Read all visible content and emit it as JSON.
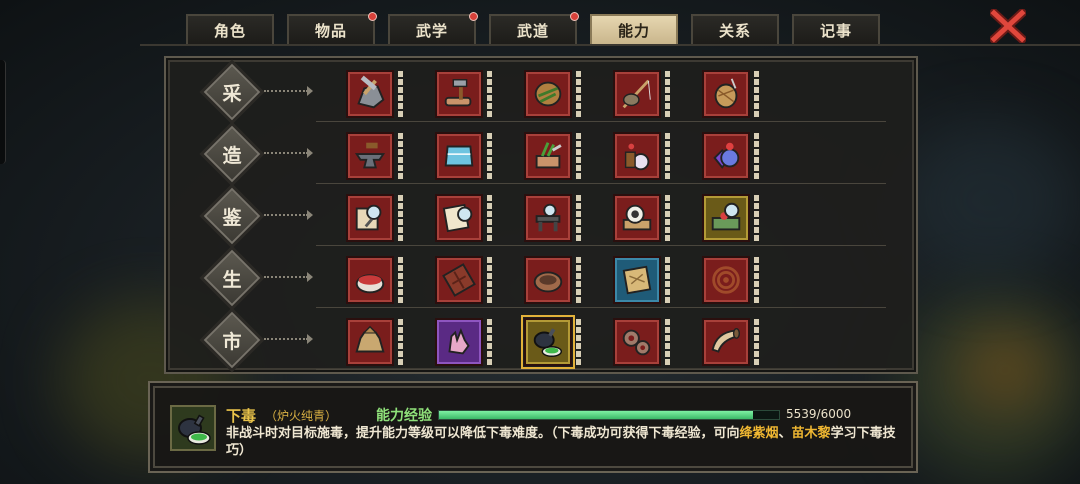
{
  "tabs": [
    {
      "label": "角色",
      "dot": false,
      "active": false
    },
    {
      "label": "物品",
      "dot": true,
      "active": false
    },
    {
      "label": "武学",
      "dot": true,
      "active": false
    },
    {
      "label": "武道",
      "dot": true,
      "active": false
    },
    {
      "label": "能力",
      "dot": false,
      "active": true
    },
    {
      "label": "关系",
      "dot": false,
      "active": false
    },
    {
      "label": "记事",
      "dot": false,
      "active": false
    }
  ],
  "close_icon": "close-x-icon",
  "rows": [
    {
      "label": "采",
      "skills": [
        {
          "icon": "ore-mining-icon",
          "color": "red",
          "level": 5
        },
        {
          "icon": "axe-wood-icon",
          "color": "red",
          "level": 5
        },
        {
          "icon": "herb-basket-icon",
          "color": "red",
          "level": 5
        },
        {
          "icon": "fishing-rod-icon",
          "color": "red",
          "level": 5
        },
        {
          "icon": "thread-spool-icon",
          "color": "red",
          "level": 5
        }
      ]
    },
    {
      "label": "造",
      "skills": [
        {
          "icon": "anvil-icon",
          "color": "red",
          "level": 5
        },
        {
          "icon": "tailoring-icon",
          "color": "red",
          "level": 5
        },
        {
          "icon": "herb-cutting-icon",
          "color": "red",
          "level": 5
        },
        {
          "icon": "alchemy-icon",
          "color": "red",
          "level": 5
        },
        {
          "icon": "gem-crafting-icon",
          "color": "red",
          "level": 5
        }
      ]
    },
    {
      "label": "鉴",
      "skills": [
        {
          "icon": "appraise-weapon-icon",
          "color": "red",
          "level": 5
        },
        {
          "icon": "appraise-scroll-icon",
          "color": "red",
          "level": 5
        },
        {
          "icon": "appraise-stand-icon",
          "color": "red",
          "level": 5
        },
        {
          "icon": "appraise-jade-icon",
          "color": "red",
          "level": 5
        },
        {
          "icon": "appraise-treasure-icon",
          "color": "gold",
          "level": 5
        }
      ]
    },
    {
      "label": "生",
      "skills": [
        {
          "icon": "cooking-pot-icon",
          "color": "red",
          "level": 5
        },
        {
          "icon": "chocolate-bar-icon",
          "color": "red",
          "level": 5
        },
        {
          "icon": "bowl-icon",
          "color": "red",
          "level": 5
        },
        {
          "icon": "map-scroll-icon",
          "color": "blue",
          "level": 5
        },
        {
          "icon": "whip-rope-icon",
          "color": "red",
          "level": 5
        }
      ]
    },
    {
      "label": "市",
      "skills": [
        {
          "icon": "money-bag-icon",
          "color": "red",
          "level": 5
        },
        {
          "icon": "steal-hand-icon",
          "color": "purple",
          "level": 5
        },
        {
          "icon": "poison-flask-icon",
          "color": "gold",
          "level": 5,
          "selected": true
        },
        {
          "icon": "gears-icon",
          "color": "red",
          "level": 5
        },
        {
          "icon": "horn-icon",
          "color": "red",
          "level": 5
        }
      ]
    }
  ],
  "info": {
    "icon": "poison-flask-icon",
    "name": "下毒",
    "sub": "（炉火纯青）",
    "exp_label": "能力经验",
    "exp_current": 5539,
    "exp_max": 6000,
    "exp_text": "5539/6000",
    "desc_part1": "非战斗时对目标施毒，提升能力等级可以降低下毒难度。（下毒成功可获得下毒经验，可向",
    "desc_name1": "绛紫烟",
    "desc_sep": "、",
    "desc_name2": "苗木黎",
    "desc_part2": "学习下毒技巧）"
  },
  "colors": {
    "red": "#7a1d1c",
    "blue": "#1f5b78",
    "purple": "#5a2a84",
    "gold": "#6a5a18",
    "exp_fill": "#3cb868",
    "highlight": "#f0b832"
  }
}
